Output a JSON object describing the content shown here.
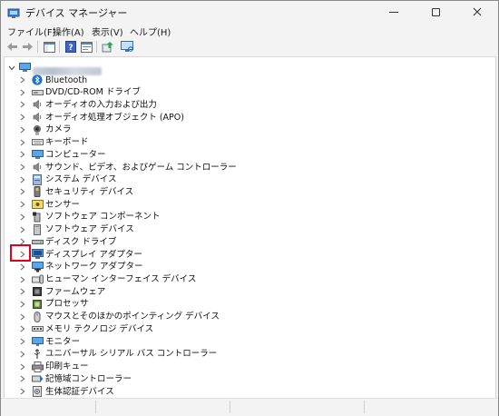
{
  "window": {
    "title": "デバイス マネージャー"
  },
  "menu": [
    "ファイル(F)",
    "操作(A)",
    "表示(V)",
    "ヘルプ(H)"
  ],
  "toolbar": [
    "back-arrow-icon",
    "forward-arrow-icon",
    "show-hide-console-tree-icon",
    "help-icon",
    "properties-icon",
    "update-driver-icon",
    "monitor-scan-icon"
  ],
  "tree": {
    "root_label": "",
    "items": [
      {
        "label": "Bluetooth",
        "icon": "bluetooth-icon"
      },
      {
        "label": "DVD/CD-ROM ドライブ",
        "icon": "dvd-drive-icon"
      },
      {
        "label": "オーディオの入力および出力",
        "icon": "speaker-icon"
      },
      {
        "label": "オーディオ処理オブジェクト (APO)",
        "icon": "speaker-icon"
      },
      {
        "label": "カメラ",
        "icon": "camera-icon"
      },
      {
        "label": "キーボード",
        "icon": "keyboard-icon"
      },
      {
        "label": "コンピューター",
        "icon": "computer-icon"
      },
      {
        "label": "サウンド、ビデオ、およびゲーム コントローラー",
        "icon": "speaker-icon"
      },
      {
        "label": "システム デバイス",
        "icon": "system-device-icon"
      },
      {
        "label": "セキュリティ デバイス",
        "icon": "security-key-icon"
      },
      {
        "label": "センサー",
        "icon": "sensor-icon"
      },
      {
        "label": "ソフトウェア コンポーネント",
        "icon": "software-component-icon"
      },
      {
        "label": "ソフトウェア デバイス",
        "icon": "software-device-icon"
      },
      {
        "label": "ディスク ドライブ",
        "icon": "disk-drive-icon"
      },
      {
        "label": "ディスプレイ アダプター",
        "icon": "display-adapter-icon"
      },
      {
        "label": "ネットワーク アダプター",
        "icon": "network-adapter-icon"
      },
      {
        "label": "ヒューマン インターフェイス デバイス",
        "icon": "hid-icon"
      },
      {
        "label": "ファームウェア",
        "icon": "firmware-icon"
      },
      {
        "label": "プロセッサ",
        "icon": "processor-icon"
      },
      {
        "label": "マウスとそのほかのポインティング デバイス",
        "icon": "mouse-icon"
      },
      {
        "label": "メモリ テクノロジ デバイス",
        "icon": "memory-icon"
      },
      {
        "label": "モニター",
        "icon": "monitor-icon"
      },
      {
        "label": "ユニバーサル シリアル バス コントローラー",
        "icon": "usb-icon"
      },
      {
        "label": "印刷キュー",
        "icon": "printer-icon"
      },
      {
        "label": "記憶域コントローラー",
        "icon": "storage-controller-icon"
      },
      {
        "label": "生体認証デバイス",
        "icon": "biometric-icon"
      }
    ]
  },
  "colors": {
    "highlight": "#e0001b",
    "accent": "#1a73c8"
  }
}
